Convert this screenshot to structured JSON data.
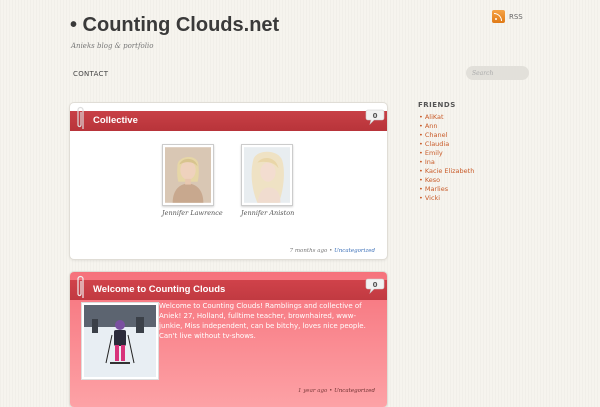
{
  "header": {
    "title": "• Counting Clouds.net",
    "tagline": "Anieks blog & portfolio",
    "rss_label": "RSS"
  },
  "nav": {
    "contact": "CONTACT"
  },
  "search": {
    "placeholder": "Search"
  },
  "posts": [
    {
      "title": "Collective",
      "comment_count": "0",
      "items": [
        {
          "name": "Jennifer Lawrence"
        },
        {
          "name": "Jennifer Aniston"
        }
      ],
      "meta_time": "7 months ago",
      "meta_sep": " • ",
      "meta_category": "Uncategorized"
    },
    {
      "title": "Welcome to Counting Clouds",
      "comment_count": "0",
      "excerpt": "Welcome to Counting Clouds! Ramblings and collective of Aniek! 27, Holland, fulltime teacher, brownhaired, www-junkie, Miss independent, can be bitchy, loves nice people. Can't live without tv-shows.",
      "meta_time": "1 year ago",
      "meta_sep": " • ",
      "meta_category": "Uncategorized"
    }
  ],
  "sidebar": {
    "friends_title": "FRIENDS",
    "friends": [
      "AliKat",
      "Ann",
      "Chanel",
      "Claudia",
      "Emily",
      "Ina",
      "Kacie Elizabeth",
      "Keso",
      "Marlies",
      "Vicki"
    ]
  },
  "colors": {
    "accent_red": "#c0393f",
    "link_orange": "#c95c2a",
    "category_blue": "#3a6fb8"
  }
}
